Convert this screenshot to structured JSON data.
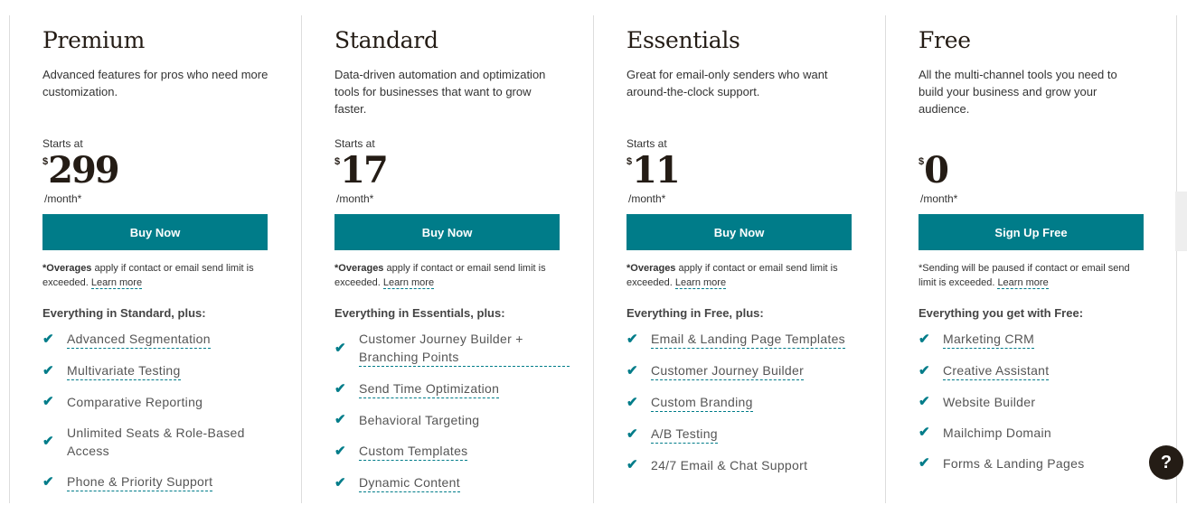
{
  "plans": [
    {
      "title": "Premium",
      "desc": "Advanced features for pros who need more customization.",
      "starts": "Starts at",
      "currency": "$",
      "price": "299",
      "per": "/month*",
      "button": "Buy Now",
      "note_bold": "*Overages",
      "note": " apply if contact or email send limit is exceeded. ",
      "learn": "Learn more",
      "everything": "Everything in Standard, plus:",
      "features": [
        {
          "t": "Advanced Segmentation",
          "link": true
        },
        {
          "t": "Multivariate Testing",
          "link": true
        },
        {
          "t": "Comparative Reporting",
          "link": false
        },
        {
          "t": "Unlimited Seats & Role-Based Access",
          "link": false
        },
        {
          "t": "Phone & Priority Support",
          "link": true
        }
      ]
    },
    {
      "title": "Standard",
      "desc": "Data-driven automation and optimization tools for businesses that want to grow faster.",
      "starts": "Starts at",
      "currency": "$",
      "price": "17",
      "per": "/month*",
      "button": "Buy Now",
      "note_bold": "*Overages",
      "note": " apply if contact or email send limit is exceeded. ",
      "learn": "Learn more",
      "everything": "Everything in Essentials, plus:",
      "features": [
        {
          "t": "Customer Journey Builder + Branching Points",
          "link": true
        },
        {
          "t": "Send Time Optimization",
          "link": true
        },
        {
          "t": "Behavioral Targeting",
          "link": false
        },
        {
          "t": "Custom Templates",
          "link": true
        },
        {
          "t": "Dynamic Content",
          "link": true
        }
      ]
    },
    {
      "title": "Essentials",
      "desc": "Great for email-only senders who want around-the-clock support.",
      "starts": "Starts at",
      "currency": "$",
      "price": "11",
      "per": "/month*",
      "button": "Buy Now",
      "note_bold": "*Overages",
      "note": " apply if contact or email send limit is exceeded. ",
      "learn": "Learn more",
      "everything": "Everything in Free, plus:",
      "features": [
        {
          "t": "Email & Landing Page Templates",
          "link": true
        },
        {
          "t": "Customer Journey Builder",
          "link": true
        },
        {
          "t": "Custom Branding",
          "link": true
        },
        {
          "t": "A/B Testing",
          "link": true
        },
        {
          "t": "24/7 Email & Chat Support",
          "link": false
        }
      ]
    },
    {
      "title": "Free",
      "desc": "All the multi-channel tools you need to build your business and grow your audience.",
      "starts": "",
      "currency": "$",
      "price": "0",
      "per": "/month*",
      "button": "Sign Up Free",
      "note_bold": "",
      "note": "*Sending will be paused if contact or email send limit is exceeded. ",
      "learn": "Learn more",
      "everything": "Everything you get with Free:",
      "features": [
        {
          "t": "Marketing CRM",
          "link": true
        },
        {
          "t": "Creative Assistant",
          "link": true
        },
        {
          "t": "Website Builder",
          "link": false
        },
        {
          "t": "Mailchimp Domain",
          "link": false
        },
        {
          "t": "Forms & Landing Pages",
          "link": false
        }
      ]
    }
  ],
  "help": "?",
  "colors": {
    "accent": "#007c89",
    "text": "#241c15"
  }
}
